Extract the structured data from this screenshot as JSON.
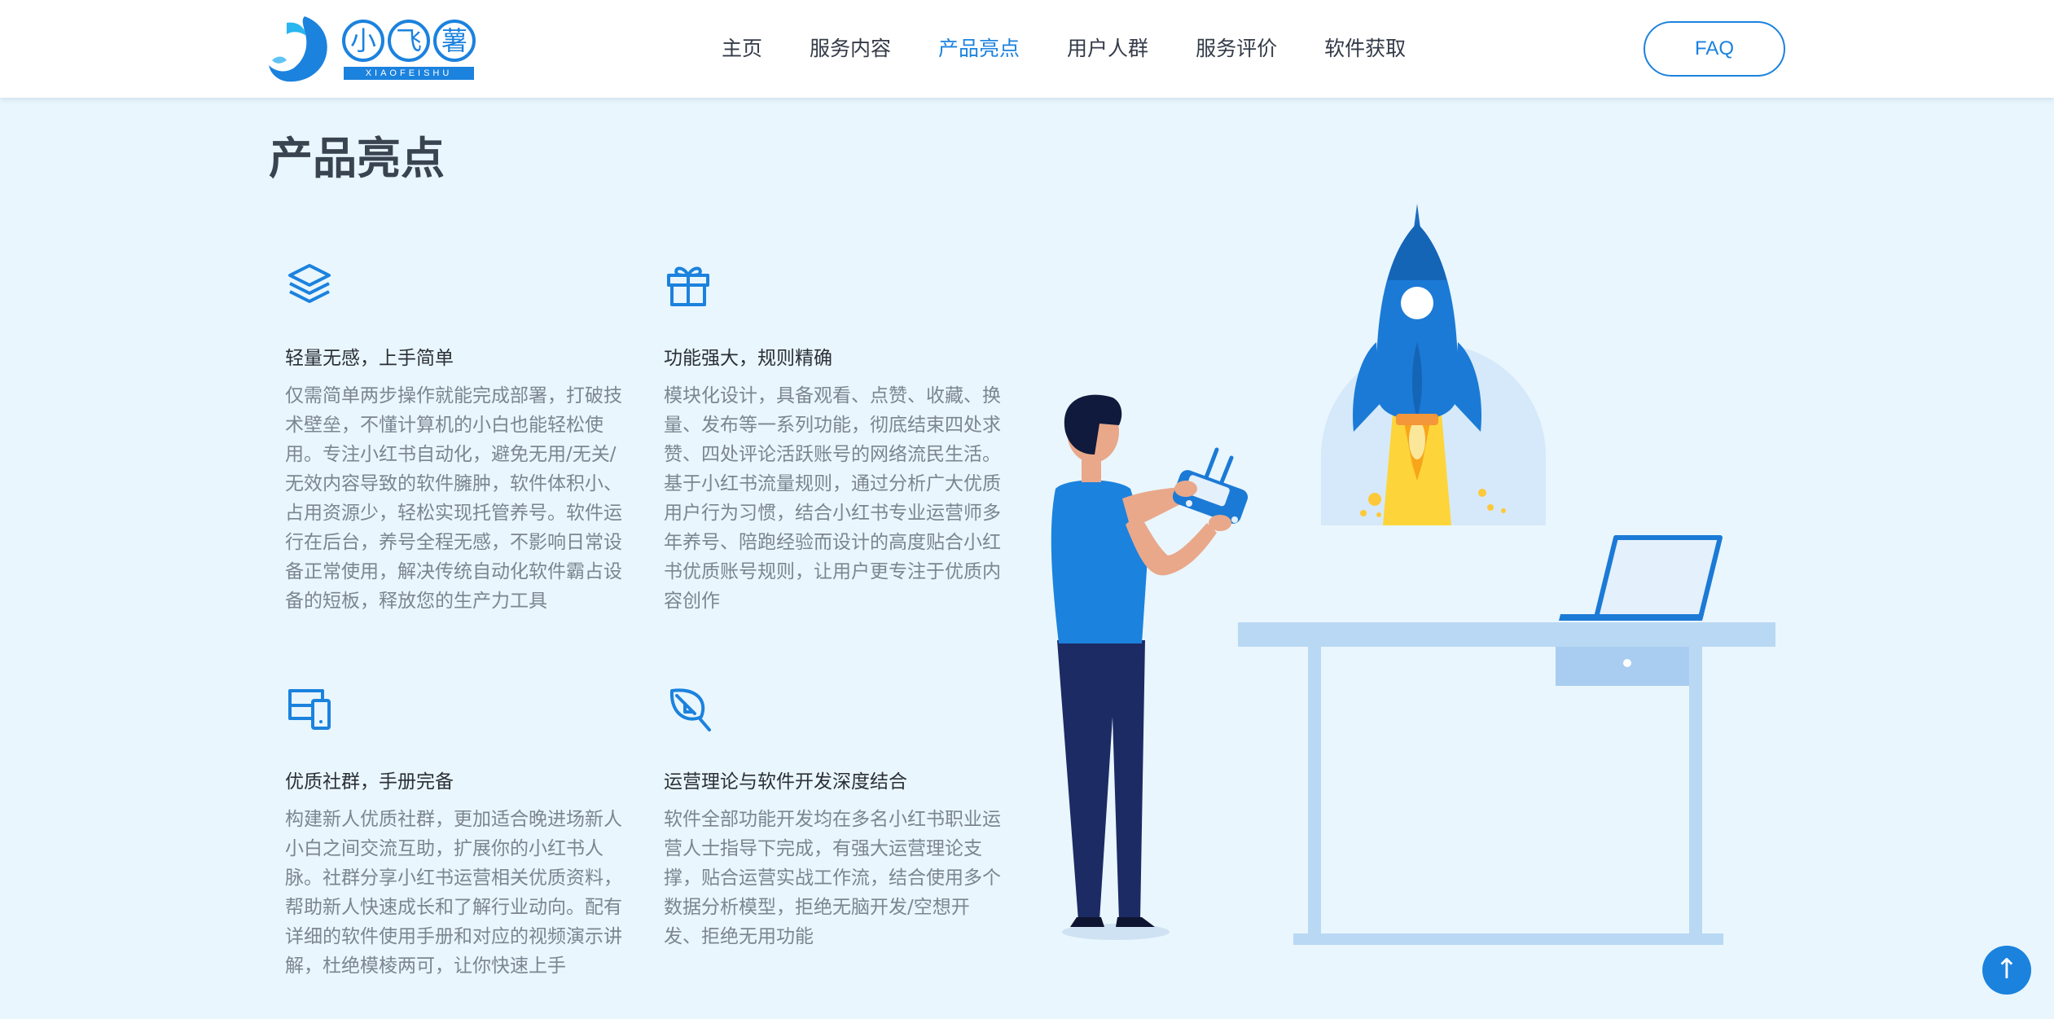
{
  "brand": {
    "chars": [
      "小",
      "飞",
      "薯"
    ],
    "subtitle": "XIAOFEISHU",
    "color": "#1b82de"
  },
  "nav": {
    "items": [
      {
        "label": "主页",
        "active": false
      },
      {
        "label": "服务内容",
        "active": false
      },
      {
        "label": "产品亮点",
        "active": true
      },
      {
        "label": "用户人群",
        "active": false
      },
      {
        "label": "服务评价",
        "active": false
      },
      {
        "label": "软件获取",
        "active": false
      }
    ],
    "faq_label": "FAQ"
  },
  "section": {
    "title": "产品亮点",
    "features": [
      {
        "icon": "layers-icon",
        "title": "轻量无感，上手简单",
        "description": "仅需简单两步操作就能完成部署，打破技术壁垒，不懂计算机的小白也能轻松使用。专注小红书自动化，避免无用/无关/无效内容导致的软件臃肿，软件体积小、占用资源少，轻松实现托管养号。软件运行在后台，养号全程无感，不影响日常设备正常使用，解决传统自动化软件霸占设备的短板，释放您的生产力工具"
      },
      {
        "icon": "gift-icon",
        "title": "功能强大，规则精确",
        "description": "模块化设计，具备观看、点赞、收藏、换量、发布等一系列功能，彻底结束四处求赞、四处评论活跃账号的网络流民生活。基于小红书流量规则，通过分析广大优质用户行为习惯，结合小红书专业运营师多年养号、陪跑经验而设计的高度贴合小红书优质账号规则，让用户更专注于优质内容创作"
      },
      {
        "icon": "devices-icon",
        "title": "优质社群，手册完备",
        "description": "构建新人优质社群，更加适合晚进场新人小白之间交流互助，扩展你的小红书人脉。社群分享小红书运营相关优质资料，帮助新人快速成长和了解行业动向。配有详细的软件使用手册和对应的视频演示讲解，杜绝模棱两可，让你快速上手"
      },
      {
        "icon": "leaf-icon",
        "title": "运营理论与软件开发深度结合",
        "description": "软件全部功能开发均在多名小红书职业运营人士指导下完成，有强大运营理论支撑，贴合运营实战工作流，结合使用多个数据分析模型，拒绝无脑开发/空想开发、拒绝无用功能"
      }
    ]
  },
  "illustration": {
    "name": "rocket-launch-illustration"
  },
  "back_to_top": {
    "icon": "arrow-up-icon",
    "glyph": "↑"
  }
}
